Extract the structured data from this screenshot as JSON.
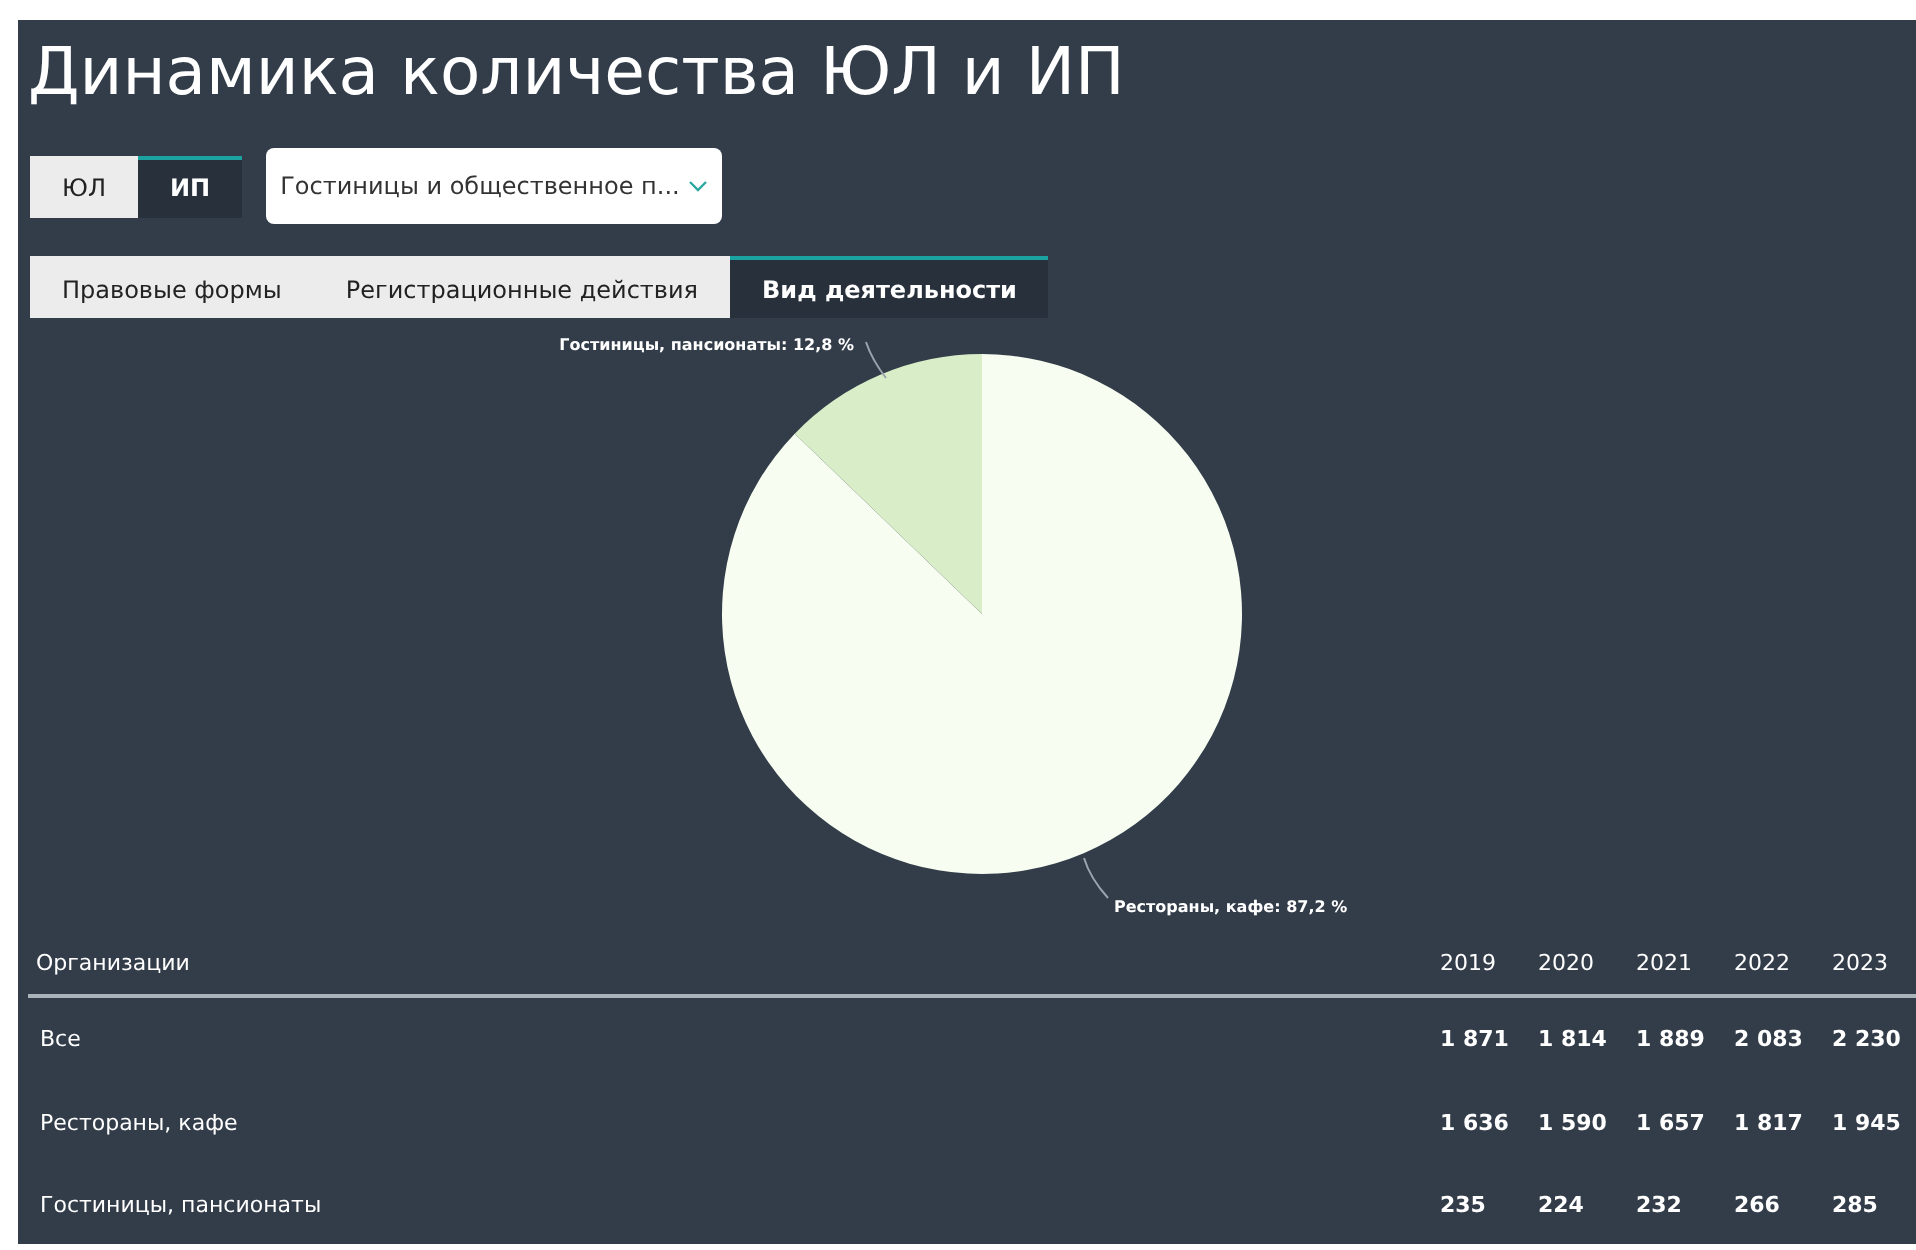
{
  "title": "Динамика количества ЮЛ и ИП",
  "entity_toggle": [
    {
      "label": "ЮЛ",
      "selected": false
    },
    {
      "label": "ИП",
      "selected": true
    }
  ],
  "industry_select": {
    "value": "Гостиницы и общественное п..."
  },
  "tabs": [
    {
      "label": "Правовые формы",
      "selected": false
    },
    {
      "label": "Регистрационные действия",
      "selected": false
    },
    {
      "label": "Вид деятельности",
      "selected": true
    }
  ],
  "chart_data": {
    "type": "pie",
    "categories": [
      "Рестораны, кафе",
      "Гостиницы, пансионаты"
    ],
    "values": [
      87.2,
      12.8
    ],
    "colors": [
      "#f7fdf1",
      "#d9edc9"
    ],
    "value_labels": [
      ": 87,2 %",
      ": 12,8 %"
    ]
  },
  "table": {
    "columns": [
      "Организации",
      "2019",
      "2020",
      "2021",
      "2022",
      "2023"
    ],
    "rows": [
      [
        "Все",
        "1 871",
        "1 814",
        "1 889",
        "2 083",
        "2 230"
      ],
      [
        "Рестораны, кафе",
        "1 636",
        "1 590",
        "1 657",
        "1 817",
        "1 945"
      ],
      [
        "Гостиницы, пансионаты",
        "235",
        "224",
        "232",
        "266",
        "285"
      ]
    ]
  }
}
